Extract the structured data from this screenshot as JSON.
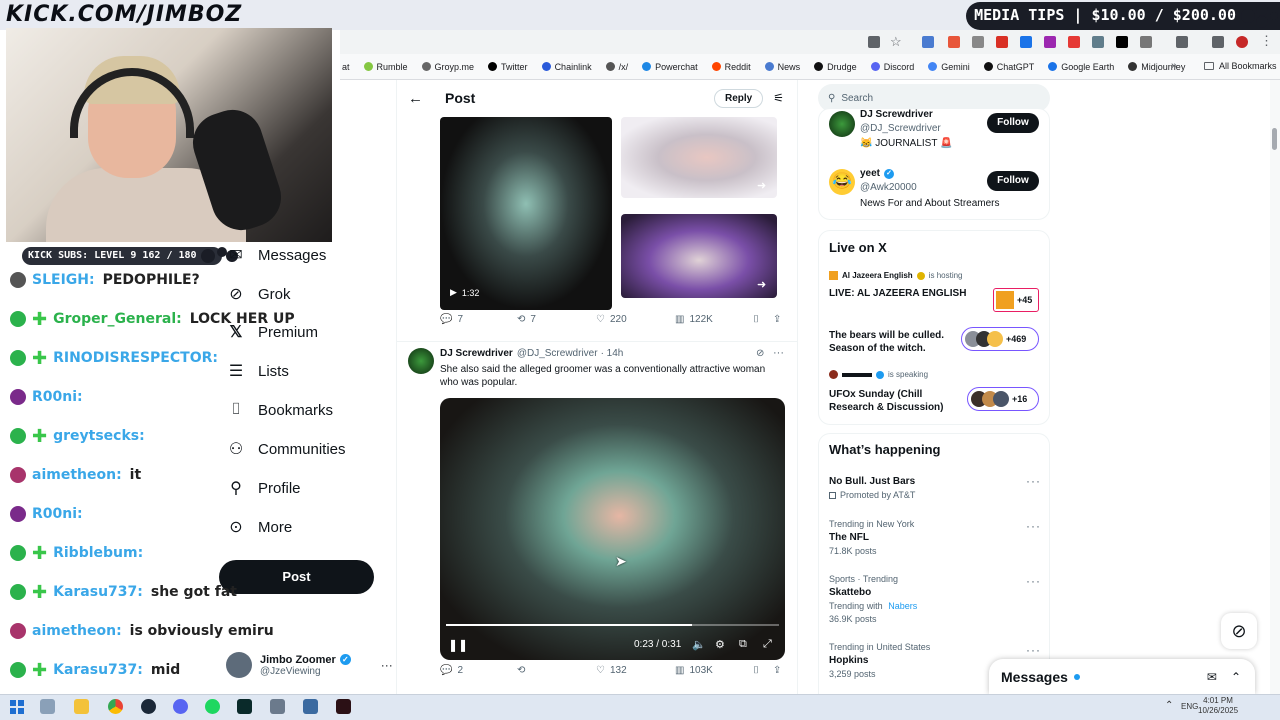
{
  "overlay": {
    "logo_text": "KICK.COM/JIMBOZ",
    "promo_text": "MEDIA TIPS | $10.00 / $200.00",
    "subs_text": "KICK SUBS: LEVEL 9 162 / 180"
  },
  "bookmarks": [
    {
      "label": "at",
      "color": "#777"
    },
    {
      "label": "Rumble",
      "color": "#85c742"
    },
    {
      "label": "Groyp.me",
      "color": "#666"
    },
    {
      "label": "Twitter",
      "color": "#000"
    },
    {
      "label": "Chainlink",
      "color": "#2a5ada"
    },
    {
      "label": "/x/",
      "color": "#555"
    },
    {
      "label": "Powerchat",
      "color": "#1e88e5"
    },
    {
      "label": "Reddit",
      "color": "#ff4500"
    },
    {
      "label": "News",
      "color": "#4a7bd0"
    },
    {
      "label": "Drudge",
      "color": "#111"
    },
    {
      "label": "Discord",
      "color": "#5865f2"
    },
    {
      "label": "Gemini",
      "color": "#4285f4"
    },
    {
      "label": "ChatGPT",
      "color": "#111"
    },
    {
      "label": "Google Earth",
      "color": "#1a73e8"
    },
    {
      "label": "Midjourney",
      "color": "#333"
    }
  ],
  "all_bookmarks": "All Bookmarks",
  "chat": [
    {
      "user": "SLEIGH:",
      "msg": "PEDOPHILE?",
      "color": "#3aa7e8"
    },
    {
      "user": "Groper_General:",
      "msg": "LOCK HER UP",
      "color": "#2bb24c"
    },
    {
      "user": "RINODISRESPECTOR:",
      "msg": "",
      "color": "#3aa7e8"
    },
    {
      "user": "R00ni:",
      "msg": "",
      "color": "#3aa7e8"
    },
    {
      "user": "greytsecks:",
      "msg": "",
      "color": "#3aa7e8"
    },
    {
      "user": "aimetheon:",
      "msg": "it",
      "color": "#3aa7e8"
    },
    {
      "user": "R00ni:",
      "msg": "",
      "color": "#3aa7e8"
    },
    {
      "user": "Ribblebum:",
      "msg": "",
      "color": "#3aa7e8"
    },
    {
      "user": "Karasu737:",
      "msg": "she got fat",
      "color": "#3aa7e8"
    },
    {
      "user": "aimetheon:",
      "msg": "is obviously emiru",
      "color": "#3aa7e8"
    },
    {
      "user": "Karasu737:",
      "msg": "mid",
      "color": "#3aa7e8"
    }
  ],
  "nav": {
    "messages": "Messages",
    "grok": "Grok",
    "premium": "Premium",
    "lists": "Lists",
    "bookmarks": "Bookmarks",
    "communities": "Communities",
    "profile": "Profile",
    "more": "More",
    "post_button": "Post",
    "account_name": "Jimbo Zoomer",
    "account_handle": "@JzeViewing"
  },
  "post_header": {
    "title": "Post",
    "reply": "Reply"
  },
  "tweet1": {
    "video_time": "1:32",
    "replies": "7",
    "retweets": "7",
    "likes": "220",
    "views": "122K"
  },
  "tweet2": {
    "name": "DJ Screwdriver",
    "handle": "@DJ_Screwdriver",
    "time": "· 14h",
    "text": "She also said the alleged groomer was a conventionally attractive woman who was popular.",
    "player_time": "0:23 / 0:31",
    "progress": 0.74,
    "replies": "2",
    "likes": "132",
    "views": "103K"
  },
  "search": {
    "placeholder": "Search"
  },
  "who_to_follow": [
    {
      "name": "DJ Screwdriver",
      "handle": "@DJ_Screwdriver",
      "bio": "😹 JOURNALIST 🚨",
      "button": "Follow"
    },
    {
      "name": "yeet",
      "handle": "@Awk20000",
      "bio": "News For and About Streamers",
      "button": "Follow"
    }
  ],
  "live": {
    "title": "Live on X",
    "items": [
      {
        "host": "Al Jazeera English",
        "status": "is hosting",
        "title": "LIVE: AL JAZEERA ENGLISH",
        "count": "+45"
      },
      {
        "host": "",
        "status": "",
        "title": "The bears will be culled. Season of the witch.",
        "count": "+469"
      },
      {
        "host": "",
        "status": "is speaking",
        "title": "UFOx Sunday (Chill Research & Discussion)",
        "count": "+16"
      }
    ]
  },
  "happening": {
    "title": "What’s happening",
    "items": [
      {
        "context": "",
        "title": "No Bull. Just Bars",
        "sub": "Promoted by AT&T"
      },
      {
        "context": "Trending in New York",
        "title": "The NFL",
        "sub": "71.8K posts"
      },
      {
        "context": "Sports · Trending",
        "title": "Skattebo",
        "sub_prefix": "Trending with",
        "sub_link": "Nabers",
        "sub": "36.9K posts"
      },
      {
        "context": "Trending in United States",
        "title": "Hopkins",
        "sub": "3,259 posts"
      }
    ]
  },
  "messages_drawer": {
    "label": "Messages"
  },
  "taskbar": {
    "lang": "ENG",
    "time": "4:01 PM",
    "date": "10/26/2025"
  }
}
